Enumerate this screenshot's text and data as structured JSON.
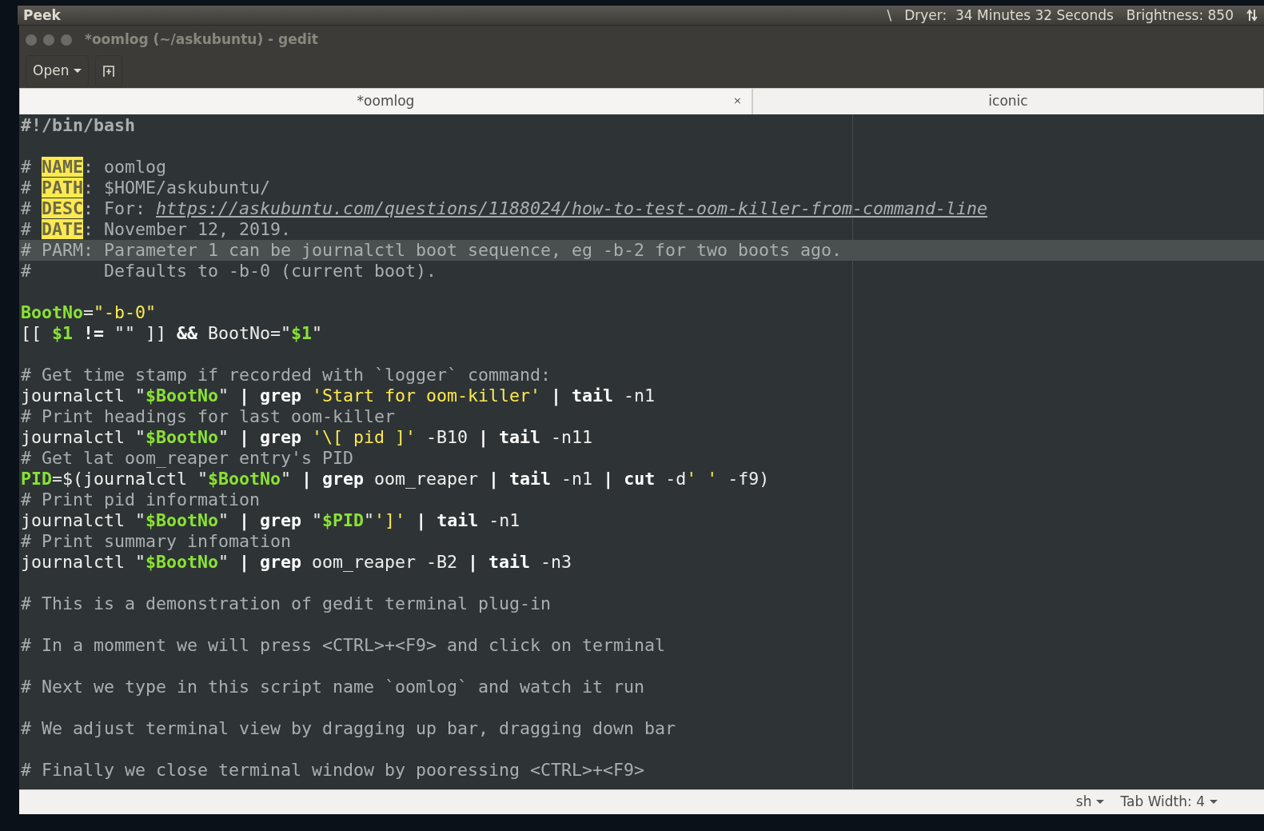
{
  "top_panel": {
    "app_name": "Peek",
    "indicators": [
      {
        "text": "\\"
      },
      {
        "text": "Dryer:  34 Minutes 32 Seconds"
      },
      {
        "text": "Brightness: 850"
      }
    ]
  },
  "window": {
    "title": "*oomlog (~/askubuntu) - gedit"
  },
  "toolbar": {
    "open_button": "Open"
  },
  "tabs": [
    {
      "label": "*oomlog",
      "selected": true,
      "close_glyph": "×"
    },
    {
      "label": "iconic",
      "selected": false
    }
  ],
  "editor": {
    "blocks": [
      {
        "lines": [
          {
            "current": false,
            "segments": [
              {
                "kind": "shebang",
                "text": "#!/bin/bash"
              }
            ]
          }
        ]
      },
      {
        "lines": [
          {
            "current": false,
            "segments": [
              {
                "kind": "comment",
                "text": "# "
              },
              {
                "kind": "tag",
                "text": "NAME"
              },
              {
                "kind": "comment",
                "text": ": oomlog"
              }
            ]
          },
          {
            "current": false,
            "segments": [
              {
                "kind": "comment",
                "text": "# "
              },
              {
                "kind": "tag",
                "text": "PATH"
              },
              {
                "kind": "comment",
                "text": ": $HOME/askubuntu/"
              }
            ]
          },
          {
            "current": false,
            "segments": [
              {
                "kind": "comment",
                "text": "# "
              },
              {
                "kind": "tag",
                "text": "DESC"
              },
              {
                "kind": "comment",
                "text": ": For: "
              },
              {
                "kind": "link",
                "text": "https://askubuntu.com/questions/1188024/how-to-test-oom-killer-from-command-line"
              }
            ]
          },
          {
            "current": false,
            "segments": [
              {
                "kind": "comment",
                "text": "# "
              },
              {
                "kind": "tag",
                "text": "DATE"
              },
              {
                "kind": "comment",
                "text": ": November 12, 2019."
              }
            ]
          },
          {
            "current": true,
            "segments": [
              {
                "kind": "comment",
                "text": "# PARM: Parameter 1 can be journalctl boot sequence, eg -b-2 for two boots ago."
              }
            ]
          },
          {
            "current": false,
            "segments": [
              {
                "kind": "comment",
                "text": "#       Defaults to -b-0 (current boot)."
              }
            ]
          }
        ]
      },
      {
        "lines": [
          {
            "current": false,
            "segments": [
              {
                "kind": "var",
                "text": "BootNo"
              },
              {
                "kind": "text",
                "text": "="
              },
              {
                "kind": "str",
                "text": "\"-b-0\""
              }
            ]
          },
          {
            "current": false,
            "segments": [
              {
                "kind": "text",
                "text": "[[ "
              },
              {
                "kind": "var",
                "text": "$1"
              },
              {
                "kind": "bold",
                "text": " !="
              },
              {
                "kind": "text",
                "text": " \"\" ]] "
              },
              {
                "kind": "bold",
                "text": "&&"
              },
              {
                "kind": "text",
                "text": " BootNo=\""
              },
              {
                "kind": "var",
                "text": "$1"
              },
              {
                "kind": "text",
                "text": "\""
              }
            ]
          }
        ]
      },
      {
        "lines": [
          {
            "current": false,
            "segments": [
              {
                "kind": "comment",
                "text": "# Get time stamp if recorded with `logger` command:"
              }
            ]
          },
          {
            "current": false,
            "segments": [
              {
                "kind": "text",
                "text": "journalctl \""
              },
              {
                "kind": "var",
                "text": "$BootNo"
              },
              {
                "kind": "text",
                "text": "\""
              },
              {
                "kind": "bold",
                "text": " | grep "
              },
              {
                "kind": "str",
                "text": "'Start for oom-killer'"
              },
              {
                "kind": "bold",
                "text": " | tail"
              },
              {
                "kind": "text",
                "text": " -n1"
              }
            ]
          },
          {
            "current": false,
            "segments": [
              {
                "kind": "comment",
                "text": "# Print headings for last oom-killer"
              }
            ]
          },
          {
            "current": false,
            "segments": [
              {
                "kind": "text",
                "text": "journalctl \""
              },
              {
                "kind": "var",
                "text": "$BootNo"
              },
              {
                "kind": "text",
                "text": "\""
              },
              {
                "kind": "bold",
                "text": " | grep "
              },
              {
                "kind": "str",
                "text": "'\\[ pid ]'"
              },
              {
                "kind": "text",
                "text": " -B10"
              },
              {
                "kind": "bold",
                "text": " | tail"
              },
              {
                "kind": "text",
                "text": " -n11"
              }
            ]
          },
          {
            "current": false,
            "segments": [
              {
                "kind": "comment",
                "text": "# Get lat oom_reaper entry's PID"
              }
            ]
          },
          {
            "current": false,
            "segments": [
              {
                "kind": "var",
                "text": "PID"
              },
              {
                "kind": "text",
                "text": "=$(journalctl \""
              },
              {
                "kind": "var",
                "text": "$BootNo"
              },
              {
                "kind": "text",
                "text": "\""
              },
              {
                "kind": "bold",
                "text": " | grep"
              },
              {
                "kind": "text",
                "text": " oom_reaper"
              },
              {
                "kind": "bold",
                "text": " | tail"
              },
              {
                "kind": "text",
                "text": " -n1"
              },
              {
                "kind": "bold",
                "text": " | cut"
              },
              {
                "kind": "text",
                "text": " -d"
              },
              {
                "kind": "str",
                "text": "' '"
              },
              {
                "kind": "text",
                "text": " -f9)"
              }
            ]
          },
          {
            "current": false,
            "segments": [
              {
                "kind": "comment",
                "text": "# Print pid information"
              }
            ]
          },
          {
            "current": false,
            "segments": [
              {
                "kind": "text",
                "text": "journalctl \""
              },
              {
                "kind": "var",
                "text": "$BootNo"
              },
              {
                "kind": "text",
                "text": "\""
              },
              {
                "kind": "bold",
                "text": " | grep"
              },
              {
                "kind": "text",
                "text": " \""
              },
              {
                "kind": "var",
                "text": "$PID"
              },
              {
                "kind": "text",
                "text": "\""
              },
              {
                "kind": "str",
                "text": "']'"
              },
              {
                "kind": "bold",
                "text": " | tail"
              },
              {
                "kind": "text",
                "text": " -n1"
              }
            ]
          },
          {
            "current": false,
            "segments": [
              {
                "kind": "comment",
                "text": "# Print summary infomation"
              }
            ]
          },
          {
            "current": false,
            "segments": [
              {
                "kind": "text",
                "text": "journalctl \""
              },
              {
                "kind": "var",
                "text": "$BootNo"
              },
              {
                "kind": "text",
                "text": "\""
              },
              {
                "kind": "bold",
                "text": " | grep"
              },
              {
                "kind": "text",
                "text": " oom_reaper -B2"
              },
              {
                "kind": "bold",
                "text": " | tail"
              },
              {
                "kind": "text",
                "text": " -n3"
              }
            ]
          }
        ]
      },
      {
        "lines": [
          {
            "current": false,
            "segments": [
              {
                "kind": "comment",
                "text": "# This is a demonstration of gedit terminal plug-in"
              }
            ]
          }
        ]
      },
      {
        "lines": [
          {
            "current": false,
            "segments": [
              {
                "kind": "comment",
                "text": "# In a momment we will press <CTRL>+<F9> and click on terminal"
              }
            ]
          }
        ]
      },
      {
        "lines": [
          {
            "current": false,
            "segments": [
              {
                "kind": "comment",
                "text": "# Next we type in this script name `oomlog` and watch it run"
              }
            ]
          }
        ]
      },
      {
        "lines": [
          {
            "current": false,
            "segments": [
              {
                "kind": "comment",
                "text": "# We adjust terminal view by dragging up bar, dragging down bar"
              }
            ]
          }
        ]
      },
      {
        "lines": [
          {
            "current": false,
            "segments": [
              {
                "kind": "comment",
                "text": "# Finally we close terminal window by pooressing <CTRL>+<F9>"
              }
            ]
          }
        ]
      }
    ]
  },
  "status_bar": {
    "language": "sh",
    "tab_width": "Tab Width: 4"
  }
}
